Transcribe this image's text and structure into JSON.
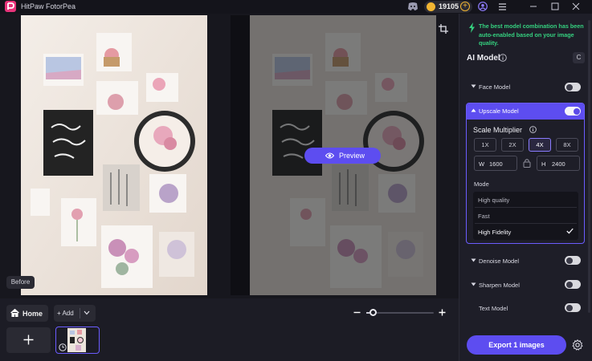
{
  "app": {
    "title": "HitPaw FotorPea",
    "coins": "19105",
    "coin_plus": "+"
  },
  "canvas": {
    "before_label": "Before",
    "preview_label": "Preview"
  },
  "bottom": {
    "home_label": "Home",
    "add_label": "+ Add",
    "zoom_level": 0.05
  },
  "panel": {
    "notice": "The best model combination has been auto-enabled based on your image quality.",
    "ai_model_title": "AI Model",
    "reset_label": "C",
    "models": {
      "face": {
        "label": "Face Model",
        "on": false
      },
      "upscale": {
        "label": "Upscale Model",
        "on": true
      },
      "denoise": {
        "label": "Denoise Model",
        "on": false
      },
      "sharpen": {
        "label": "Sharpen Model",
        "on": false
      },
      "text": {
        "label": "Text Model",
        "on": false
      }
    },
    "scale": {
      "title": "Scale Multiplier",
      "options": [
        "1X",
        "2X",
        "4X",
        "8X"
      ],
      "selected": "4X",
      "width_label": "W",
      "width_value": "1600",
      "height_label": "H",
      "height_value": "2400"
    },
    "mode": {
      "label": "Mode",
      "options": [
        "High quality",
        "Fast",
        "High Fidelity"
      ],
      "selected": "High Fidelity"
    },
    "export_label": "Export 1 images"
  },
  "colors": {
    "accent": "#5d4df0",
    "notice_green": "#35d07f",
    "coin_gold": "#f2b532"
  },
  "icons": [
    "app-logo-icon",
    "discord-icon",
    "coin-icon",
    "user-icon",
    "menu-icon",
    "minimize-icon",
    "maximize-icon",
    "close-icon",
    "crop-icon",
    "eye-icon",
    "home-icon",
    "chevron-down-icon",
    "zoom-out-icon",
    "zoom-in-icon",
    "plus-icon",
    "clock-icon",
    "bolt-icon",
    "info-icon",
    "lock-icon",
    "check-icon",
    "settings-icon"
  ]
}
